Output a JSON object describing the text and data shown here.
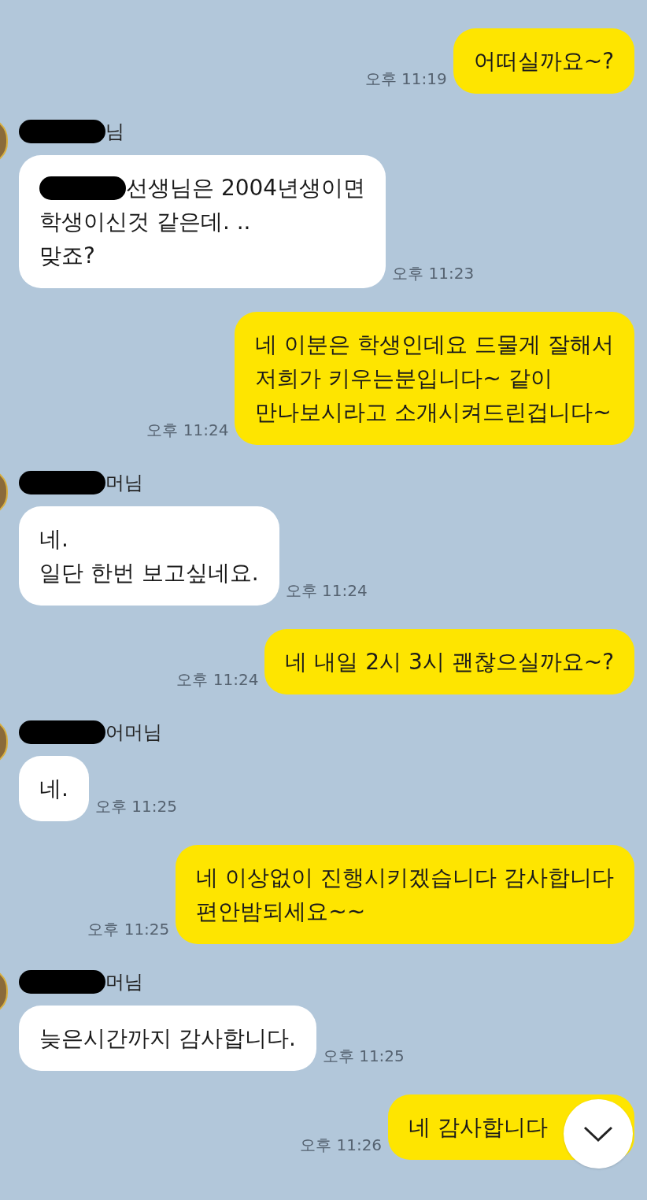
{
  "messages": [
    {
      "kind": "sent",
      "lines": [
        "어떠실까요~?"
      ],
      "time": "오후 11:19"
    },
    {
      "kind": "received",
      "sender": "님",
      "redacted_sender": true,
      "lines": [
        "선생님은 2004년생이면",
        "학생이신것 같은데. ..",
        "맞죠?"
      ],
      "redacted_start": true,
      "time": "오후 11:23"
    },
    {
      "kind": "sent",
      "lines": [
        "네 이분은 학생인데요 드물게 잘해서",
        "저희가 키우는분입니다~ 같이",
        "만나보시라고 소개시켜드린겁니다~"
      ],
      "time": "오후 11:24"
    },
    {
      "kind": "received",
      "sender": "머님",
      "redacted_sender": true,
      "lines": [
        "네.",
        "일단 한번 보고싶네요."
      ],
      "redacted_start": false,
      "time": "오후 11:24"
    },
    {
      "kind": "sent",
      "lines": [
        "네 내일 2시 3시 괜찮으실까요~?"
      ],
      "time": "오후 11:24"
    },
    {
      "kind": "received",
      "sender": "어머님",
      "redacted_sender": true,
      "lines": [
        "네."
      ],
      "redacted_start": false,
      "time": "오후 11:25"
    },
    {
      "kind": "sent",
      "lines": [
        "네 이상없이 진행시키겠습니다 감사합니다",
        "편안밤되세요~~"
      ],
      "time": "오후 11:25"
    },
    {
      "kind": "received",
      "sender": "머님",
      "redacted_sender": true,
      "lines": [
        "늦은시간까지 감사합니다."
      ],
      "redacted_start": false,
      "time": "오후 11:25"
    },
    {
      "kind": "sent",
      "lines": [
        "네 감사합니다"
      ],
      "time": "오후 11:26"
    }
  ]
}
